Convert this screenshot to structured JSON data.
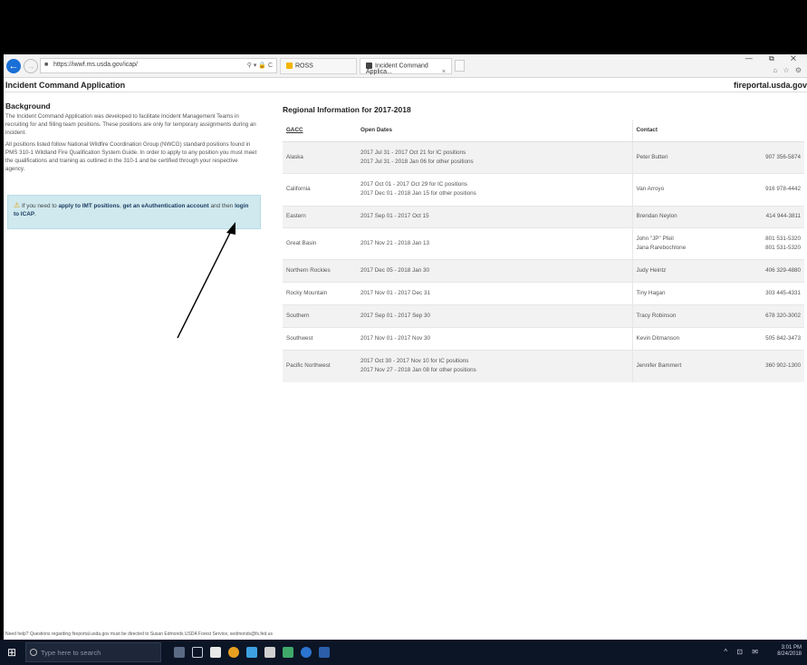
{
  "browser": {
    "url": "https://iwwf.ms.usda.gov/icap/",
    "tabs": [
      {
        "label": "ROSS"
      },
      {
        "label": "Incident Command Applica...",
        "close": "×"
      }
    ],
    "window_controls": "— ⧉ ✕",
    "toolbar_icons": "⌂ ☆ ⚙"
  },
  "header": {
    "title": "Incident Command Application",
    "domain": "fireportal.usda.gov"
  },
  "background": {
    "title": "Background",
    "p1": "The Incident Command Application was developed to facilitate Incident Management Teams in recruiting for and filling team positions. These positions are only for temporary assignments during an incident.",
    "p2": "All positions listed follow National Wildfire Coordination Group (NWCG) standard positions found in PMS 310-1 Wildland Fire Qualification System Guide. In order to apply to any position you must meet the qualifications and training as outlined in the 310-1 and be certified through your respective agency."
  },
  "alert": {
    "prefix": "If you need to",
    "link1": "apply to IMT positions",
    "middle": ",",
    "link2": "get an eAuthentication account",
    "middle2": "and then",
    "link3": "login to ICAP",
    "suffix": "."
  },
  "regional": {
    "title": "Regional Information for 2017-2018",
    "headers": {
      "gacc": "GACC",
      "dates": "Open Dates",
      "contact": "Contact"
    },
    "rows": [
      {
        "gacc": "Alaska",
        "dates1": "2017 Jul 31 - 2017 Oct 21 for IC positions",
        "dates2": "2017 Jul 31 - 2018 Jan 06 for other positions",
        "contact1": "Peter Butteri",
        "contact2": "",
        "phone1": "907 356-5874",
        "phone2": ""
      },
      {
        "gacc": "California",
        "dates1": "2017 Oct 01 - 2017 Oct 29 for IC positions",
        "dates2": "2017 Dec 01 - 2018 Jan 15 for other positions",
        "contact1": "Van Arroyo",
        "contact2": "",
        "phone1": "916 978-4442",
        "phone2": ""
      },
      {
        "gacc": "Eastern",
        "dates1": "2017 Sep 01 - 2017 Oct 15",
        "dates2": "",
        "contact1": "Brendan Neylon",
        "contact2": "",
        "phone1": "414 944-3811",
        "phone2": ""
      },
      {
        "gacc": "Great Basin",
        "dates1": "2017 Nov 21 - 2018 Jan 13",
        "dates2": "",
        "contact1": "John \"JP\" Pfeil",
        "contact2": "Jana Rarebochlone",
        "phone1": "801 531-5320",
        "phone2": "801 531-5320"
      },
      {
        "gacc": "Northern Rockies",
        "dates1": "2017 Dec 05 - 2018 Jan 30",
        "dates2": "",
        "contact1": "Judy Heintz",
        "contact2": "",
        "phone1": "406 329-4880",
        "phone2": ""
      },
      {
        "gacc": "Rocky Mountain",
        "dates1": "2017 Nov 01 - 2017 Dec 31",
        "dates2": "",
        "contact1": "Tiny Hagan",
        "contact2": "",
        "phone1": "303 445-4331",
        "phone2": ""
      },
      {
        "gacc": "Southern",
        "dates1": "2017 Sep 01 - 2017 Sep 30",
        "dates2": "",
        "contact1": "Tracy Robinson",
        "contact2": "",
        "phone1": "678 320-3002",
        "phone2": ""
      },
      {
        "gacc": "Southwest",
        "dates1": "2017 Nov 01 - 2017 Nov 30",
        "dates2": "",
        "contact1": "Kevin Ditmanson",
        "contact2": "",
        "phone1": "505 842-3473",
        "phone2": ""
      },
      {
        "gacc": "Pacific Northwest",
        "dates1": "2017 Oct 30 - 2017 Nov 10 for IC positions",
        "dates2": "2017 Nov 27 - 2018 Jan 08 for other positions",
        "contact1": "Jennifer Bammert",
        "contact2": "",
        "phone1": "360 902-1300",
        "phone2": ""
      }
    ]
  },
  "footer": {
    "note": "Need help? Questions regarding fireportal.usda.gov must be directed to Susan Edmonds USDA Forest Service, sedmonds@fs.fed.us"
  },
  "taskbar": {
    "search_placeholder": "Type here to search",
    "time": "3:01 PM",
    "date": "8/24/2018",
    "tray": "^ ⊡ ✉"
  },
  "colors": {
    "alert_bg": "#cfe9ef",
    "link": "#1a3a5e",
    "taskbar": "#0c1526",
    "accent": "#1a6fd6"
  }
}
